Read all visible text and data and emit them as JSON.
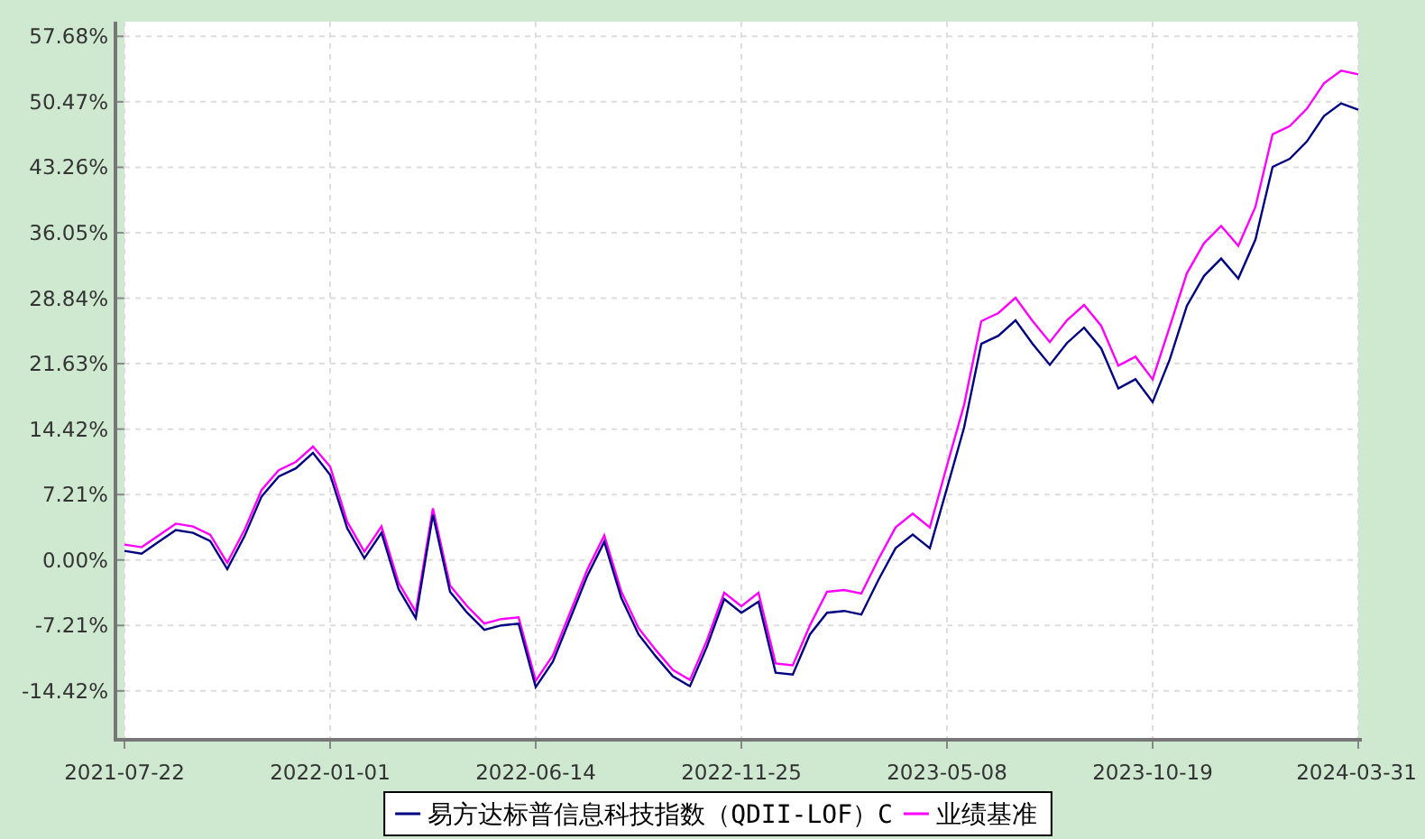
{
  "chart_data": {
    "type": "line",
    "categories": [
      "2021-07-22",
      null,
      null,
      null,
      null,
      null,
      null,
      null,
      null,
      null,
      null,
      null,
      "2022-01-01",
      null,
      null,
      null,
      null,
      null,
      null,
      null,
      null,
      null,
      null,
      null,
      "2022-06-14",
      null,
      null,
      null,
      null,
      null,
      null,
      null,
      null,
      null,
      null,
      null,
      "2022-11-25",
      null,
      null,
      null,
      null,
      null,
      null,
      null,
      null,
      null,
      null,
      null,
      "2023-05-08",
      null,
      null,
      null,
      null,
      null,
      null,
      null,
      null,
      null,
      null,
      null,
      "2023-10-19",
      null,
      null,
      null,
      null,
      null,
      null,
      null,
      null,
      null,
      null,
      null,
      "2024-03-31"
    ],
    "series": [
      {
        "name": "易方达标普信息科技指数（QDII-LOF）C",
        "color": "#000080",
        "values": [
          1.0,
          0.7,
          2.0,
          3.3,
          3.0,
          2.1,
          -1.0,
          2.6,
          7.0,
          9.2,
          10.1,
          11.8,
          9.4,
          3.5,
          0.2,
          3.0,
          -3.2,
          -6.4,
          5.0,
          -3.5,
          -5.8,
          -7.7,
          -7.2,
          -7.0,
          -14.0,
          -11.2,
          -6.5,
          -1.8,
          2.0,
          -4.2,
          -8.2,
          -10.6,
          -12.8,
          -13.9,
          -9.5,
          -4.3,
          -5.8,
          -4.6,
          -12.4,
          -12.6,
          -8.2,
          -5.8,
          -5.6,
          -6.0,
          -2.2,
          1.3,
          2.8,
          1.3,
          7.9,
          14.6,
          23.8,
          24.7,
          26.4,
          23.8,
          21.5,
          23.9,
          25.6,
          23.3,
          18.9,
          19.9,
          17.4,
          22.1,
          28.0,
          31.3,
          33.2,
          31.0,
          35.3,
          43.3,
          44.2,
          46.1,
          48.9,
          50.3,
          49.6
        ]
      },
      {
        "name": "业绩基准",
        "color": "#ff00ff",
        "values": [
          1.7,
          1.4,
          2.7,
          4.0,
          3.7,
          2.8,
          -0.3,
          3.3,
          7.7,
          9.9,
          10.8,
          12.5,
          10.3,
          4.2,
          0.9,
          3.7,
          -2.5,
          -5.7,
          5.7,
          -2.8,
          -5.1,
          -7.0,
          -6.5,
          -6.3,
          -13.3,
          -10.5,
          -5.8,
          -1.1,
          2.7,
          -3.5,
          -7.5,
          -9.9,
          -12.1,
          -13.2,
          -8.8,
          -3.6,
          -5.1,
          -3.6,
          -11.4,
          -11.6,
          -7.2,
          -3.5,
          -3.3,
          -3.7,
          0.1,
          3.6,
          5.1,
          3.6,
          10.4,
          17.1,
          26.3,
          27.2,
          28.9,
          26.3,
          24.0,
          26.4,
          28.1,
          25.8,
          21.4,
          22.4,
          19.9,
          25.7,
          31.6,
          34.9,
          36.8,
          34.6,
          38.9,
          46.9,
          47.8,
          49.7,
          52.5,
          53.9,
          53.5
        ]
      }
    ],
    "ylim": [
      -19.8,
      59.3
    ],
    "grid": true,
    "legend": "bottom",
    "yticks": [
      {
        "value": 57.68,
        "label": "57.68%"
      },
      {
        "value": 50.47,
        "label": "50.47%"
      },
      {
        "value": 43.26,
        "label": "43.26%"
      },
      {
        "value": 36.05,
        "label": "36.05%"
      },
      {
        "value": 28.84,
        "label": "28.84%"
      },
      {
        "value": 21.63,
        "label": "21.63%"
      },
      {
        "value": 14.42,
        "label": "14.42%"
      },
      {
        "value": 7.21,
        "label": "7.21%"
      },
      {
        "value": 0,
        "label": "0.00%"
      },
      {
        "value": -7.21,
        "label": "-7.21%"
      },
      {
        "value": -14.42,
        "label": "-14.42%"
      }
    ]
  }
}
